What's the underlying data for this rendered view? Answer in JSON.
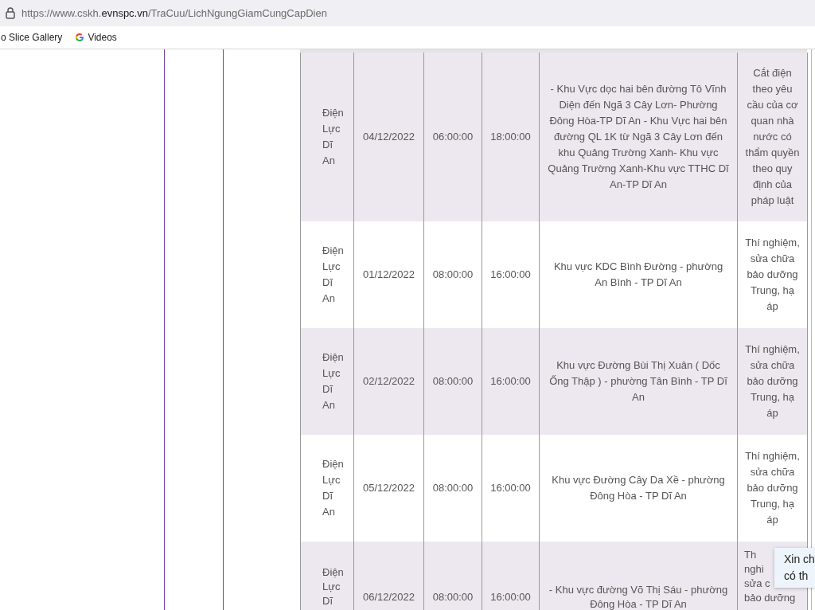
{
  "browser": {
    "url": {
      "prefix": "https://www.cskh.",
      "domain": "evnspc.vn",
      "path": "/TraCuu/LichNgungGiamCungCapDien"
    },
    "bookmarks": [
      {
        "label": "o Slice Gallery",
        "kind": "text"
      },
      {
        "label": "Videos",
        "kind": "favicon"
      }
    ]
  },
  "table": {
    "rows": [
      {
        "unit": "Điện Lực Dĩ An",
        "date": "04/12/2022",
        "start": "06:00:00",
        "end": "18:00:00",
        "area": "- Khu Vực dọc hai bên đường Tô Vĩnh Diện đến Ngã 3 Cây Lơn- Phường Đông Hòa-TP Dĩ An - Khu Vực hai bên đường QL 1K từ Ngã 3 Cây Lơn đến khu Quảng Trường Xanh- Khu vực Quảng Trường Xanh-Khu vực TTHC Dĩ An-TP Dĩ An",
        "reason": "Cắt điện theo yêu cầu của cơ quan nhà nước có thẩm quyền theo quy định của pháp luật",
        "shaded": true
      },
      {
        "unit": "Điện Lực Dĩ An",
        "date": "01/12/2022",
        "start": "08:00:00",
        "end": "16:00:00",
        "area": "Khu vực KDC Bình Đường - phường An Bình - TP Dĩ An",
        "reason": "Thí nghiệm, sửa chữa bảo dưỡng Trung, hạ áp",
        "shaded": false
      },
      {
        "unit": "Điện Lực Dĩ An",
        "date": "02/12/2022",
        "start": "08:00:00",
        "end": "16:00:00",
        "area": "Khu vực Đường Bùi Thị Xuân ( Dốc Ống Thập ) - phường Tân Bình - TP Dĩ An",
        "reason": "Thí nghiệm, sửa chữa bảo dưỡng Trung, hạ áp",
        "shaded": true
      },
      {
        "unit": "Điện Lực Dĩ An",
        "date": "05/12/2022",
        "start": "08:00:00",
        "end": "16:00:00",
        "area": "Khu vực Đường Cây Da Xề - phường Đông Hòa - TP Dĩ An",
        "reason": "Thí nghiệm, sửa chữa bảo dưỡng Trung, hạ áp",
        "shaded": false
      },
      {
        "unit": "Điện Lực Dĩ",
        "date": "06/12/2022",
        "start": "08:00:00",
        "end": "16:00:00",
        "area": "- Khu vực đường Võ Thị Sáu - phường Đông Hòa - TP Dĩ An",
        "reason": [
          "Th",
          "nghi",
          "sửa c",
          "bảo dưỡng"
        ],
        "shaded": true
      }
    ]
  },
  "tooltip": {
    "lines": [
      "Xin ch",
      "có th"
    ]
  }
}
